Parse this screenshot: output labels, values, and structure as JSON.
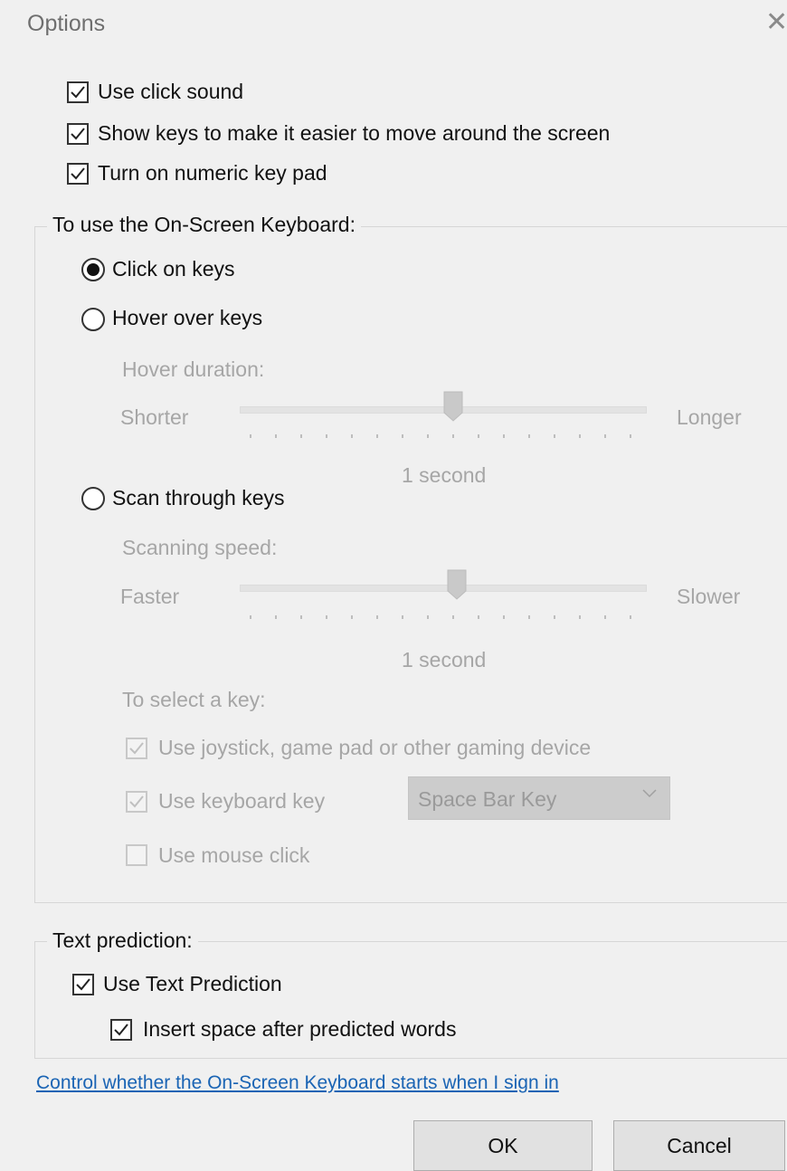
{
  "window": {
    "title": "Options",
    "close_glyph": "✕"
  },
  "options": {
    "click_sound": "Use click sound",
    "show_keys": "Show keys to make it easier to move around the screen",
    "numeric_keypad": "Turn on numeric key pad"
  },
  "keyboard_group": {
    "legend": "To use the On-Screen Keyboard:",
    "click_on_keys": "Click on keys",
    "hover_over_keys": "Hover over keys",
    "hover_duration_label": "Hover duration:",
    "hover_min": "Shorter",
    "hover_max": "Longer",
    "hover_value": "1 second",
    "scan_through_keys": "Scan through keys",
    "scan_speed_label": "Scanning speed:",
    "scan_min": "Faster",
    "scan_max": "Slower",
    "scan_value": "1 second",
    "select_key_label": "To select a key:",
    "use_joystick": "Use joystick, game pad or other gaming device",
    "use_keyboard_key": "Use keyboard key",
    "keyboard_key_selected": "Space Bar Key",
    "use_mouse_click": "Use mouse click"
  },
  "text_prediction": {
    "legend": "Text prediction:",
    "use_text_prediction": "Use Text Prediction",
    "insert_space": "Insert space after predicted words"
  },
  "link_text": "Control whether the On-Screen Keyboard starts when I sign in",
  "buttons": {
    "ok": "OK",
    "cancel": "Cancel"
  },
  "colors": {
    "link": "#1a64b4",
    "disabled_text": "#a6a6a6"
  }
}
